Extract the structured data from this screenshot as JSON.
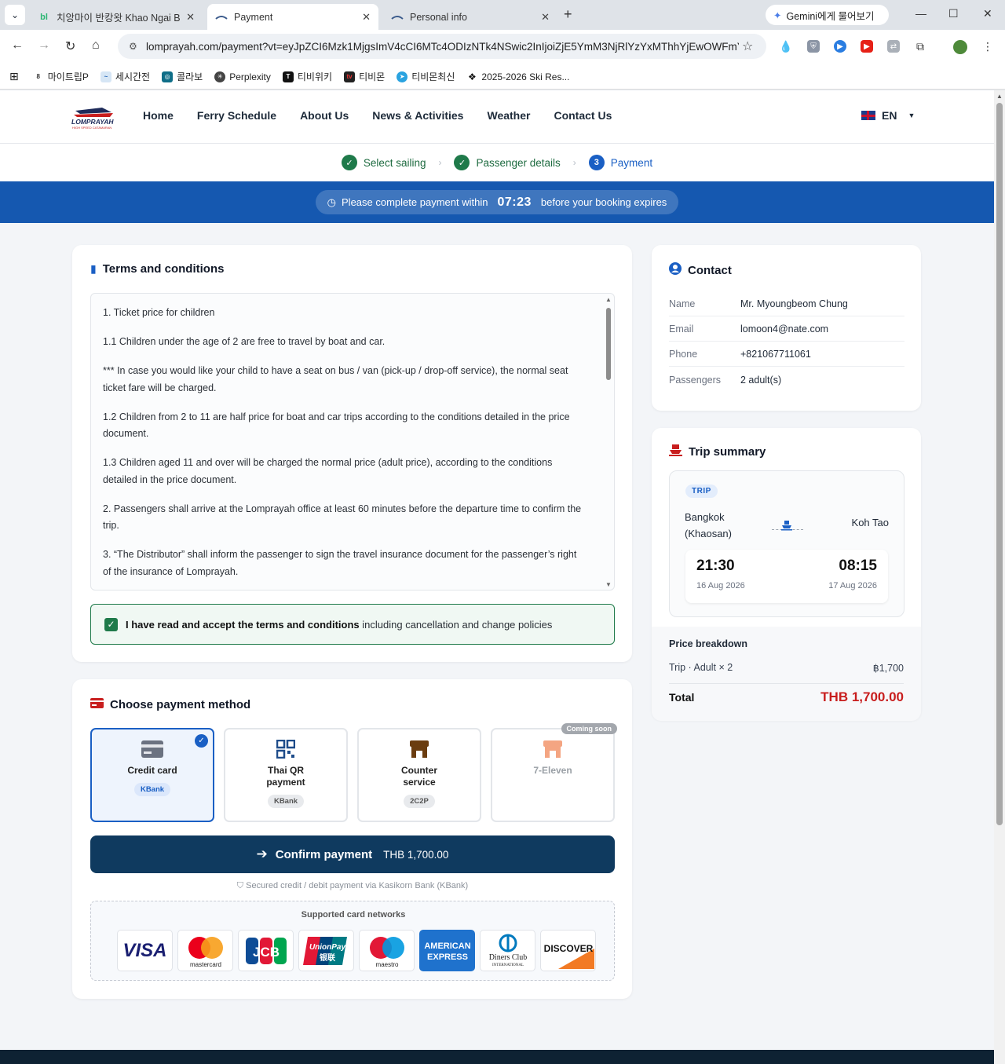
{
  "browser": {
    "tabs": [
      {
        "title": "치앙마이 반캉왓 Khao Ngai Br",
        "favicon": "bl"
      },
      {
        "title": "Payment"
      },
      {
        "title": "Personal info"
      }
    ],
    "gemini_label": "Gemini에게 물어보기",
    "url": "lomprayah.com/payment?vt=eyJpZCI6Mzk1MjgsImV4cCI6MTc4ODIzNTk4NSwic2InIjoiZjE5YmM3NjRlYzYxMThhYjEwOWFmY...",
    "bookmarks": [
      "마이트립P",
      "세시간전",
      "콜라보",
      "Perplexity",
      "티비위키",
      "티비몬",
      "티비몬최신",
      "2025-2026 Ski Res..."
    ],
    "bookmark_icon_labels": [
      "tv",
      "TV"
    ]
  },
  "site": {
    "logo_text": "LOMPRAYAH",
    "logo_subtext": "HIGH SPEED CATAMARAN",
    "nav": [
      "Home",
      "Ferry Schedule",
      "About Us",
      "News & Activities",
      "Weather",
      "Contact Us"
    ],
    "lang": "EN"
  },
  "steps": [
    {
      "label": "Select sailing",
      "mark": "✓"
    },
    {
      "label": "Passenger details",
      "mark": "✓"
    },
    {
      "label": "Payment",
      "mark": "3"
    }
  ],
  "timer": {
    "prefix": "Please complete payment within",
    "countdown": "07:23",
    "suffix": "before your booking expires"
  },
  "terms": {
    "title": "Terms and conditions",
    "paragraphs": [
      "1. Ticket price for children",
      "1.1 Children under the age of 2 are free to travel by boat and car.",
      "*** In case you would like your child to have a seat on bus / van (pick-up / drop-off service), the normal seat ticket fare will be charged.",
      "1.2 Children from 2 to 11 are half price for boat and car trips according to the conditions detailed in the price document.",
      "1.3 Children aged 11 and over will be charged the normal price (adult price), according to the conditions detailed in the price document.",
      "2. Passengers shall arrive at the Lomprayah office at least 60 minutes before the departure time to confirm the trip.",
      "3. “The Distributor” shall inform the passenger to sign the travel insurance document for the passenger’s right of the insurance of Lomprayah."
    ],
    "accept_bold": "I have read and accept the terms and conditions",
    "accept_rest": "including cancellation and change policies"
  },
  "payment": {
    "title": "Choose payment method",
    "methods": [
      {
        "label": "Credit card",
        "badge": "KBank",
        "selected": true
      },
      {
        "label": "Thai QR payment",
        "badge": "KBank"
      },
      {
        "label": "Counter service",
        "badge": "2C2P"
      },
      {
        "label": "7-Eleven",
        "badge": "",
        "coming_soon": "Coming soon"
      }
    ],
    "confirm_label": "Confirm payment",
    "confirm_amount": "THB 1,700.00",
    "secured_note": "Secured credit / debit payment via Kasikorn Bank (KBank)",
    "networks_title": "Supported card networks",
    "networks": [
      "VISA",
      "mastercard",
      "JCB",
      "UnionPay",
      "银联",
      "maestro",
      "AMERICAN",
      "EXPRESS",
      "Diners Club",
      "INTERNATIONAL",
      "DISCOVER"
    ]
  },
  "contact": {
    "title": "Contact",
    "rows": [
      {
        "k": "Name",
        "v": "Mr. Myoungbeom Chung"
      },
      {
        "k": "Email",
        "v": "lomoon4@nate.com"
      },
      {
        "k": "Phone",
        "v": "+821067711061"
      },
      {
        "k": "Passengers",
        "v": "2 adult(s)"
      }
    ]
  },
  "trip": {
    "title": "Trip summary",
    "tag": "TRIP",
    "from": "Bangkok (Khaosan)",
    "to": "Koh Tao",
    "depart_time": "21:30",
    "depart_date": "16 Aug 2026",
    "arrive_time": "08:15",
    "arrive_date": "17 Aug 2026",
    "breakdown_title": "Price breakdown",
    "line_label": "Trip · Adult × 2",
    "line_amount": "฿1,700",
    "total_label": "Total",
    "total_amount": "THB 1,700.00"
  },
  "colors": {
    "primary": "#1558b0",
    "confirm": "#0f3a5f",
    "success": "#1f7a4a",
    "total": "#c81e1e"
  }
}
